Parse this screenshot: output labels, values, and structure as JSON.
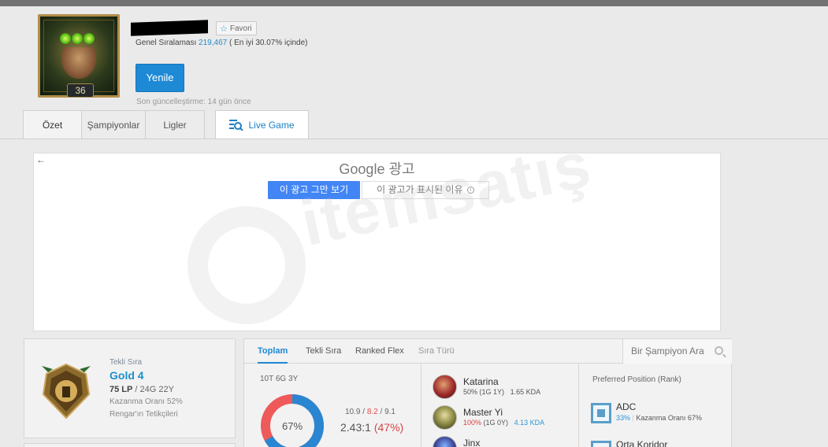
{
  "header": {
    "favorite_label": "Favori",
    "rank_prefix": "Genel Sıralaması",
    "rank_value": "219,467",
    "rank_suffix": "( En iyi 30.07% içinde)",
    "level": "36",
    "refresh_label": "Yenile",
    "updated_text": "Son güncelleştirme: 14 gün önce"
  },
  "tabs": [
    {
      "label": "Özet"
    },
    {
      "label": "Şampiyonlar"
    },
    {
      "label": "Ligler"
    },
    {
      "label": "Live Game"
    }
  ],
  "ad": {
    "title": "Google 광고",
    "stop_label": "이 광고 그만 보기",
    "why_label": "이 광고가 표시된 이유",
    "back_glyph": "←"
  },
  "watermark": {
    "text": "itemsatış"
  },
  "ranked": {
    "queue": "Tekli Sıra",
    "tier": "Gold 4",
    "lp": "75 LP",
    "record": "/ 24G 22Y",
    "winrate": "Kazanma Oranı 52%",
    "league": "Rengar'ın Tetikçileri"
  },
  "stats": {
    "tabs": [
      {
        "label": "Toplam"
      },
      {
        "label": "Tekli Sıra"
      },
      {
        "label": "Ranked Flex"
      },
      {
        "label": "Sıra Türü"
      }
    ],
    "search_placeholder": "Bir Şampiyon Ara",
    "summary": {
      "record": "10T 6G 3Y",
      "winrate_label": "67%",
      "winrate": 0.67,
      "kills": "10.9",
      "deaths": "8.2",
      "assists": "9.1",
      "sep": "/",
      "kda_ratio": "2.43:1",
      "kp": "(47%)"
    },
    "champions": [
      {
        "name": "Katarina",
        "winrate": "50%",
        "record": "(1G 1Y)",
        "kda": "1.65 KDA"
      },
      {
        "name": "Master Yi",
        "winrate": "100%",
        "record": "(1G 0Y)",
        "kda": "4.13 KDA"
      },
      {
        "name": "Jinx",
        "winrate": "",
        "record": "",
        "kda": ""
      }
    ],
    "positions": {
      "title": "Preferred Position (Rank)",
      "items": [
        {
          "name": "ADC",
          "share": "33%",
          "winrate": "Kazanma Oranı 67%"
        },
        {
          "name": "Orta Koridor",
          "share": "",
          "winrate": ""
        }
      ]
    }
  },
  "colors": {
    "accent": "#1e8ad6",
    "win": "#2a86d1",
    "loss": "#ee5a5a"
  }
}
